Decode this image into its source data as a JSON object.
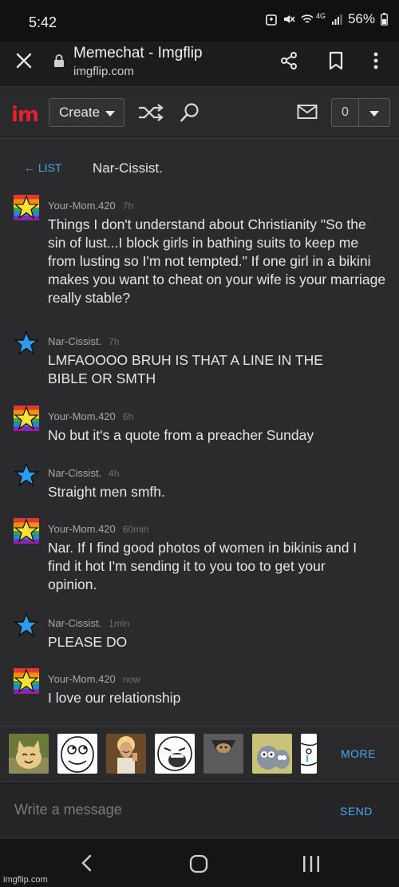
{
  "status_bar": {
    "time": "5:42",
    "network": "4G",
    "battery_pct": "56%"
  },
  "browser": {
    "title": "Memechat - Imgflip",
    "url": "imgflip.com"
  },
  "site_nav": {
    "logo": "im",
    "create_label": "Create",
    "notification_count": "0"
  },
  "chat": {
    "back_label": "← LIST",
    "partner_name": "Nar-Cissist.",
    "messages": [
      {
        "user": "Your-Mom.420",
        "time": "7h",
        "avatar": "rainbow-star",
        "text": "Things I don't understand about Christianity \"So the sin of lust...I block girls in bathing suits to keep me from lusting so I'm not tempted.\" If one girl in a bikini makes you want to cheat on your wife is your marriage really stable?"
      },
      {
        "user": "Nar-Cissist.",
        "time": "7h",
        "avatar": "blue-star",
        "text": "LMFAOOOO BRUH IS THAT A LINE IN THE BIBLE OR SMTH"
      },
      {
        "user": "Your-Mom.420",
        "time": "6h",
        "avatar": "rainbow-star",
        "text": "No but it's a quote from a preacher Sunday"
      },
      {
        "user": "Nar-Cissist.",
        "time": "4h",
        "avatar": "blue-star",
        "text": "Straight men smfh."
      },
      {
        "user": "Your-Mom.420",
        "time": "60min",
        "avatar": "rainbow-star",
        "text": "Nar. If I find good photos of women in bikinis and I find it hot I'm sending it to you too to get your opinion."
      },
      {
        "user": "Nar-Cissist.",
        "time": "1min",
        "avatar": "blue-star",
        "text": "PLEASE DO"
      },
      {
        "user": "Your-Mom.420",
        "time": "now",
        "avatar": "rainbow-star",
        "text": "I love our relationship"
      }
    ]
  },
  "meme_strip": {
    "memes": [
      "happy-cat",
      "rage-face-thinking",
      "buddy-christ",
      "lol-face",
      "ceiling-cat",
      "tom-cat-shocked",
      "crying-face"
    ],
    "more_label": "MORE"
  },
  "composer": {
    "placeholder": "Write a message",
    "send_label": "SEND"
  },
  "watermark": "imgflip.com",
  "colors": {
    "accent": "#4aa7ee",
    "logo_red": "#e2202e",
    "background": "#2b2b2d"
  }
}
